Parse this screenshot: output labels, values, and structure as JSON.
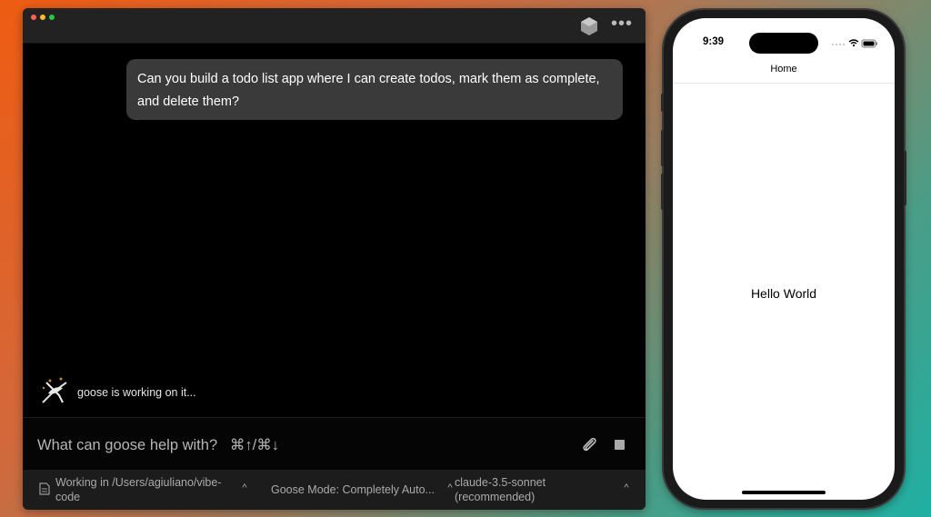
{
  "app": {
    "user_message": "Can you build a todo list app where I can create todos, mark them as complete, and delete them?",
    "status_text": "goose is working on it...",
    "input_placeholder": "What can goose help with?   ⌘↑/⌘↓",
    "statusbar": {
      "working_dir": "Working in /Users/agiuliano/vibe-code",
      "mode": "Goose Mode: Completely Auto...",
      "model": "claude-3.5-sonnet (recommended)"
    },
    "icons": {
      "logo": "goose-logo-icon",
      "more": "more-horizontal-icon",
      "attach": "paperclip-icon",
      "stop": "stop-icon",
      "doc": "document-icon",
      "chevron": "chevron-up-icon"
    }
  },
  "phone": {
    "time": "9:39",
    "nav_title": "Home",
    "content": "Hello World"
  }
}
